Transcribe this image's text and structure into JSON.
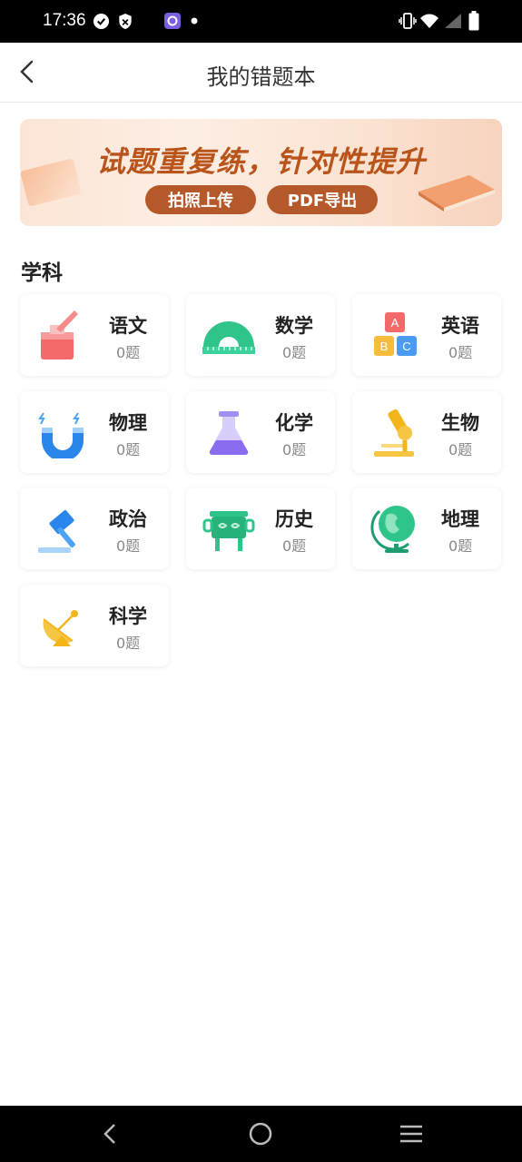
{
  "status_bar": {
    "time": "17:36",
    "icons": [
      "check-circle-icon",
      "shield-icon",
      "app-notification-icon",
      "dot-icon",
      "vibrate-icon",
      "wifi-icon",
      "signal-icon",
      "battery-icon"
    ]
  },
  "header": {
    "title": "我的错题本",
    "back_icon": "chevron-left-icon"
  },
  "banner": {
    "title": "试题重复练，针对性提升",
    "photo_upload_label": "拍照上传",
    "pdf_export_label": "PDF导出"
  },
  "section": {
    "title": "学科"
  },
  "subjects": [
    {
      "name": "语文",
      "count": "0题",
      "icon": "ink-bottle-icon"
    },
    {
      "name": "数学",
      "count": "0题",
      "icon": "protractor-icon"
    },
    {
      "name": "英语",
      "count": "0题",
      "icon": "abc-blocks-icon"
    },
    {
      "name": "物理",
      "count": "0题",
      "icon": "magnet-icon"
    },
    {
      "name": "化学",
      "count": "0题",
      "icon": "flask-icon"
    },
    {
      "name": "生物",
      "count": "0题",
      "icon": "microscope-icon"
    },
    {
      "name": "政治",
      "count": "0题",
      "icon": "gavel-icon"
    },
    {
      "name": "历史",
      "count": "0题",
      "icon": "bronze-vessel-icon"
    },
    {
      "name": "地理",
      "count": "0题",
      "icon": "globe-icon"
    },
    {
      "name": "科学",
      "count": "0题",
      "icon": "satellite-dish-icon"
    }
  ],
  "nav_bar": {
    "icons": [
      "nav-back-icon",
      "nav-home-icon",
      "nav-menu-icon"
    ]
  },
  "colors": {
    "banner_accent": "#b6592a",
    "banner_title": "#b9541b"
  }
}
